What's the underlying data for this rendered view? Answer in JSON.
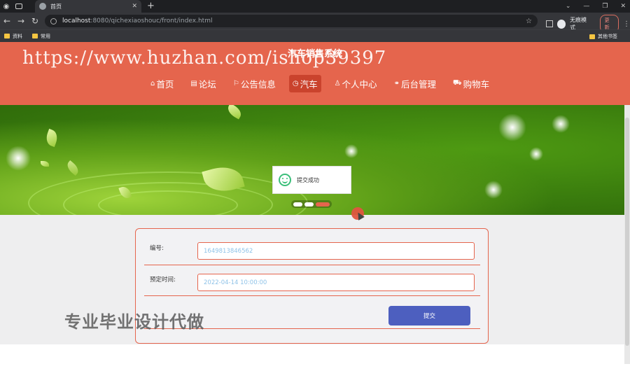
{
  "browser": {
    "tab_title": "首页",
    "url_host": "localhost",
    "url_path": ":8080/qichexiaoshouc/front/index.html",
    "incognito_label": "无痕模式",
    "update_label": "更新",
    "bookmarks": [
      "资料",
      "常用"
    ],
    "other_bookmarks": "其他书签"
  },
  "site": {
    "title": "汽车销售系统",
    "watermark": "https://www.huzhan.com/ishop39397",
    "nav": [
      {
        "icon": "⌂",
        "label": "首页"
      },
      {
        "icon": "▤",
        "label": "论坛"
      },
      {
        "icon": "⚐",
        "label": "公告信息"
      },
      {
        "icon": "◷",
        "label": "汽车"
      },
      {
        "icon": "♙",
        "label": "个人中心"
      },
      {
        "icon": "⚭",
        "label": "后台管理"
      },
      {
        "icon": "⛟",
        "label": "购物车"
      }
    ],
    "active_nav": "汽车"
  },
  "toast": {
    "message": "提交成功"
  },
  "form": {
    "id_label": "编号:",
    "id_value": "1649813846562",
    "time_label": "预定时间:",
    "time_value": "2022-04-14 10:00:00",
    "submit_label": "提交"
  },
  "ad_text": "专业毕业设计代做",
  "colors": {
    "header": "#e5654d",
    "submit": "#4d5fbf",
    "toast_icon": "#3bbf7a"
  }
}
